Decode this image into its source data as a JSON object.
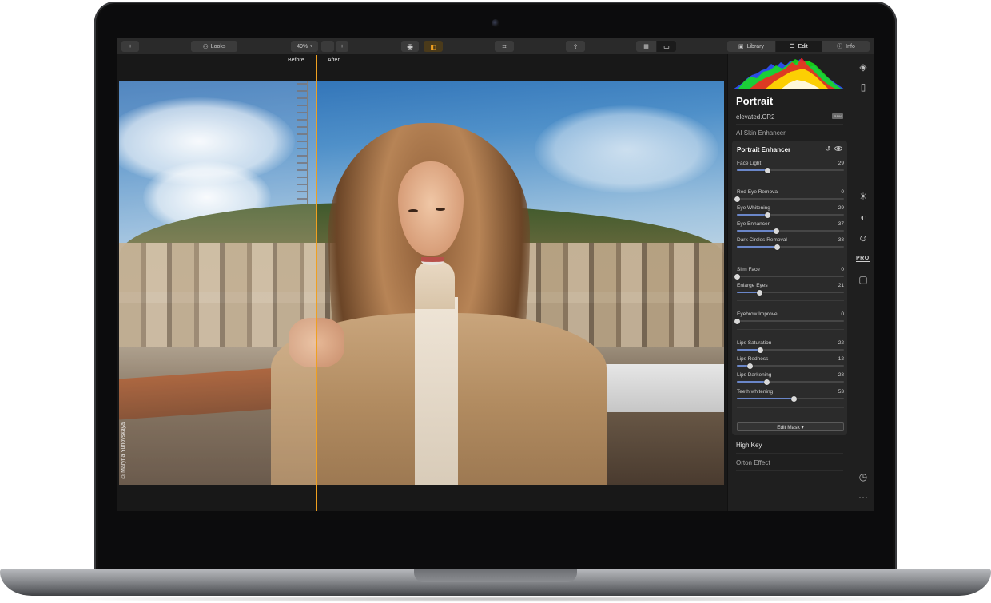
{
  "toolbar": {
    "add_label": "+",
    "looks_label": "Looks",
    "zoom_value": "49%",
    "zoom_minus": "−",
    "zoom_plus": "+",
    "tabs": [
      {
        "label": "Library",
        "selected": false
      },
      {
        "label": "Edit",
        "selected": true
      },
      {
        "label": "Info",
        "selected": false
      }
    ]
  },
  "compare": {
    "before_label": "Before",
    "after_label": "After"
  },
  "photo": {
    "watermark": "©Maryna Yurlovskaya"
  },
  "panel": {
    "title": "Portrait",
    "filename": "elevated.CR2",
    "raw_badge": "RAW",
    "sections_above": [
      "AI Skin Enhancer"
    ],
    "enhancer": {
      "title": "Portrait Enhancer",
      "sliders": [
        {
          "label": "Face Light",
          "value": 29
        },
        {
          "label": "Red Eye Removal",
          "value": 0
        },
        {
          "label": "Eye Whitening",
          "value": 29
        },
        {
          "label": "Eye Enhancer",
          "value": 37
        },
        {
          "label": "Dark Circles Removal",
          "value": 38
        },
        {
          "label": "Slim Face",
          "value": 0
        },
        {
          "label": "Enlarge Eyes",
          "value": 21
        },
        {
          "label": "Eyebrow Improve",
          "value": 0
        },
        {
          "label": "Lips Saturation",
          "value": 22
        },
        {
          "label": "Lips Redness",
          "value": 12
        },
        {
          "label": "Lips Darkening",
          "value": 28
        },
        {
          "label": "Teeth whitening",
          "value": 53
        }
      ],
      "edit_mask_label": "Edit Mask ▾"
    },
    "sections_below": [
      {
        "label": "High Key",
        "bright": true
      },
      {
        "label": "Orton Effect",
        "bright": false
      }
    ]
  },
  "colors": {
    "accent": "#f0a020",
    "slider_fill": "#6a86c8",
    "panel_bg": "#1f1f1f"
  },
  "icons": {
    "side": [
      "layers-icon",
      "compare-panels-icon",
      "sun-icon",
      "palette-icon",
      "face-icon",
      "pro-icon",
      "briefcase-icon",
      "history-clock-icon",
      "more-dots-icon"
    ]
  }
}
